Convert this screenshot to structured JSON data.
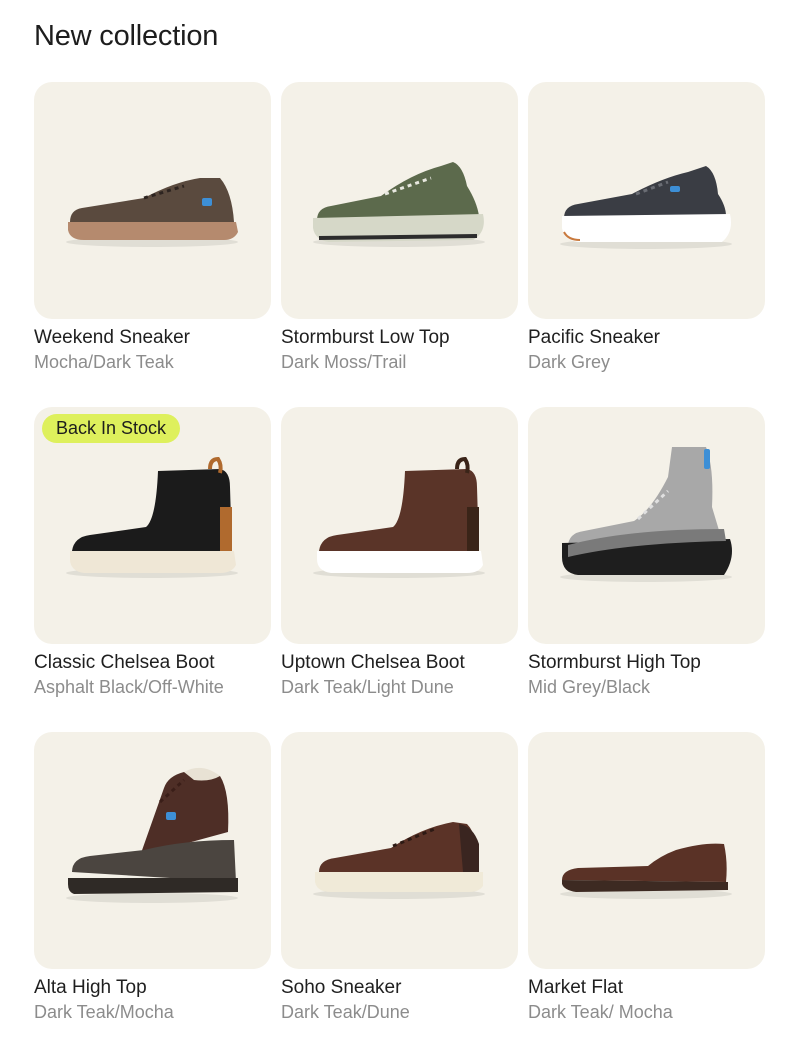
{
  "page": {
    "title": "New collection"
  },
  "products": [
    {
      "name": "Weekend Sneaker",
      "variant": "Mocha/Dark Teak",
      "badge": "",
      "shoe": "sneaker-icon",
      "colors": {
        "upper": "#5a4a3e",
        "sole": "#b58a6e",
        "accent": "#3d8fd6"
      }
    },
    {
      "name": "Stormburst Low Top",
      "variant": "Dark Moss/Trail",
      "badge": "",
      "shoe": "trail-sneaker-icon",
      "colors": {
        "upper": "#5c6a4c",
        "sole": "#d6d8c8",
        "accent": "#2c2c2c"
      }
    },
    {
      "name": "Pacific Sneaker",
      "variant": "Dark Grey",
      "badge": "",
      "shoe": "sneaker-icon",
      "colors": {
        "upper": "#3a3d44",
        "sole": "#ffffff",
        "accent": "#3d8fd6"
      }
    },
    {
      "name": "Classic Chelsea Boot",
      "variant": "Asphalt Black/Off-White",
      "badge": "Back In Stock",
      "shoe": "chelsea-boot-icon",
      "colors": {
        "upper": "#1b1b1b",
        "sole": "#efe7d6",
        "accent": "#b06a2e"
      }
    },
    {
      "name": "Uptown Chelsea Boot",
      "variant": "Dark Teak/Light Dune",
      "badge": "",
      "shoe": "chelsea-boot-icon",
      "colors": {
        "upper": "#5a3428",
        "sole": "#ffffff",
        "accent": "#3a2418"
      }
    },
    {
      "name": "Stormburst High Top",
      "variant": "Mid Grey/Black",
      "badge": "",
      "shoe": "high-top-icon",
      "colors": {
        "upper": "#a8a8a8",
        "sole": "#1e1e1e",
        "accent": "#3d8fd6"
      }
    },
    {
      "name": "Alta High Top",
      "variant": "Dark Teak/Mocha",
      "badge": "",
      "shoe": "hiking-boot-icon",
      "colors": {
        "upper": "#4e2e26",
        "sole": "#4b4540",
        "accent": "#3d8fd6"
      }
    },
    {
      "name": "Soho Sneaker",
      "variant": "Dark Teak/Dune",
      "badge": "",
      "shoe": "leather-sneaker-icon",
      "colors": {
        "upper": "#5b3327",
        "sole": "#f0ead8",
        "accent": "#3a2520"
      }
    },
    {
      "name": "Market Flat",
      "variant": "Dark Teak/ Mocha",
      "badge": "",
      "shoe": "flat-icon",
      "colors": {
        "upper": "#5a3226",
        "sole": "#3d2a22",
        "accent": "#5a3226"
      }
    }
  ]
}
